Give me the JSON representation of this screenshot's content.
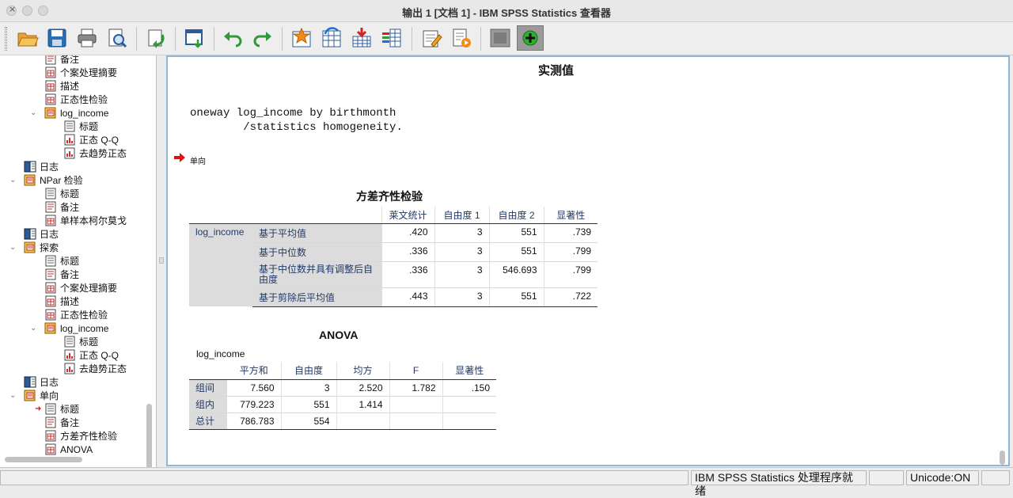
{
  "window": {
    "title": "输出 1 [文档 1] - IBM SPSS Statistics 查看器"
  },
  "toolbar": {
    "buttons": [
      {
        "icon": "open-folder-icon"
      },
      {
        "icon": "save-icon"
      },
      {
        "icon": "print-icon"
      },
      {
        "icon": "print-preview-icon"
      },
      {
        "icon": "export-icon"
      },
      {
        "icon": "recall-dialog-icon"
      },
      {
        "icon": "undo-icon"
      },
      {
        "icon": "redo-icon"
      },
      {
        "icon": "goto-case-icon"
      },
      {
        "icon": "goto-variable-icon"
      },
      {
        "icon": "insert-cases-icon"
      },
      {
        "icon": "variables-icon"
      },
      {
        "icon": "designate-window-icon"
      },
      {
        "icon": "run-script-icon"
      },
      {
        "icon": "hide-icon"
      },
      {
        "icon": "show-icon"
      }
    ]
  },
  "tree": {
    "items": [
      {
        "label": "备注",
        "indent": 2,
        "icon": "notes-icon",
        "partial": true
      },
      {
        "label": "个案处理摘要",
        "indent": 2,
        "icon": "table-icon"
      },
      {
        "label": "描述",
        "indent": 2,
        "icon": "table-icon"
      },
      {
        "label": "正态性检验",
        "indent": 2,
        "icon": "table-icon"
      },
      {
        "label": "log_income",
        "indent": 2,
        "icon": "folder-book-icon",
        "expand": true
      },
      {
        "label": "标题",
        "indent": 3,
        "icon": "title-icon"
      },
      {
        "label": "正态 Q-Q",
        "indent": 3,
        "icon": "chart-icon"
      },
      {
        "label": "去趋势正态",
        "indent": 3,
        "icon": "chart-icon"
      },
      {
        "label": "日志",
        "indent": 1,
        "icon": "log-icon"
      },
      {
        "label": "NPar 检验",
        "indent": 1,
        "icon": "folder-book-icon",
        "expand": true
      },
      {
        "label": "标题",
        "indent": 2,
        "icon": "title-icon"
      },
      {
        "label": "备注",
        "indent": 2,
        "icon": "notes-icon"
      },
      {
        "label": "单样本柯尔莫戈",
        "indent": 2,
        "icon": "table-icon"
      },
      {
        "label": "日志",
        "indent": 1,
        "icon": "log-icon"
      },
      {
        "label": "探索",
        "indent": 1,
        "icon": "folder-book-icon",
        "expand": true
      },
      {
        "label": "标题",
        "indent": 2,
        "icon": "title-icon"
      },
      {
        "label": "备注",
        "indent": 2,
        "icon": "notes-icon"
      },
      {
        "label": "个案处理摘要",
        "indent": 2,
        "icon": "table-icon"
      },
      {
        "label": "描述",
        "indent": 2,
        "icon": "table-icon"
      },
      {
        "label": "正态性检验",
        "indent": 2,
        "icon": "table-icon"
      },
      {
        "label": "log_income",
        "indent": 2,
        "icon": "folder-book-icon",
        "expand": true
      },
      {
        "label": "标题",
        "indent": 3,
        "icon": "title-icon"
      },
      {
        "label": "正态 Q-Q",
        "indent": 3,
        "icon": "chart-icon"
      },
      {
        "label": "去趋势正态",
        "indent": 3,
        "icon": "chart-icon"
      },
      {
        "label": "日志",
        "indent": 1,
        "icon": "log-icon"
      },
      {
        "label": "单向",
        "indent": 1,
        "icon": "folder-book-icon",
        "expand": true
      },
      {
        "label": "标题",
        "indent": 2,
        "icon": "title-icon",
        "current": true
      },
      {
        "label": "备注",
        "indent": 2,
        "icon": "notes-icon"
      },
      {
        "label": "方差齐性检验",
        "indent": 2,
        "icon": "table-icon"
      },
      {
        "label": "ANOVA",
        "indent": 2,
        "icon": "table-icon"
      }
    ]
  },
  "output": {
    "heading": "实测值",
    "syntax_line1": "oneway log_income by birthmonth",
    "syntax_line2": "        /statistics homogeneity.",
    "procedure_title": "单向",
    "levene": {
      "title": "方差齐性检验",
      "headers": [
        "莱文统计",
        "自由度 1",
        "自由度 2",
        "显著性"
      ],
      "row_variable": "log_income",
      "rows": [
        {
          "label": "基于平均值",
          "values": [
            ".420",
            "3",
            "551",
            ".739"
          ]
        },
        {
          "label": "基于中位数",
          "values": [
            ".336",
            "3",
            "551",
            ".799"
          ]
        },
        {
          "label": "基于中位数并具有调整后自由度",
          "values": [
            ".336",
            "3",
            "546.693",
            ".799"
          ]
        },
        {
          "label": "基于剪除后平均值",
          "values": [
            ".443",
            "3",
            "551",
            ".722"
          ]
        }
      ]
    },
    "anova": {
      "title": "ANOVA",
      "subtitle": "log_income",
      "headers": [
        "平方和",
        "自由度",
        "均方",
        "F",
        "显著性"
      ],
      "rows": [
        {
          "label": "组间",
          "values": [
            "7.560",
            "3",
            "2.520",
            "1.782",
            ".150"
          ]
        },
        {
          "label": "组内",
          "values": [
            "779.223",
            "551",
            "1.414",
            "",
            ""
          ]
        },
        {
          "label": "总计",
          "values": [
            "786.783",
            "554",
            "",
            "",
            ""
          ]
        }
      ]
    }
  },
  "status": {
    "processor": "IBM SPSS Statistics 处理程序就绪",
    "unicode": "Unicode:ON"
  }
}
